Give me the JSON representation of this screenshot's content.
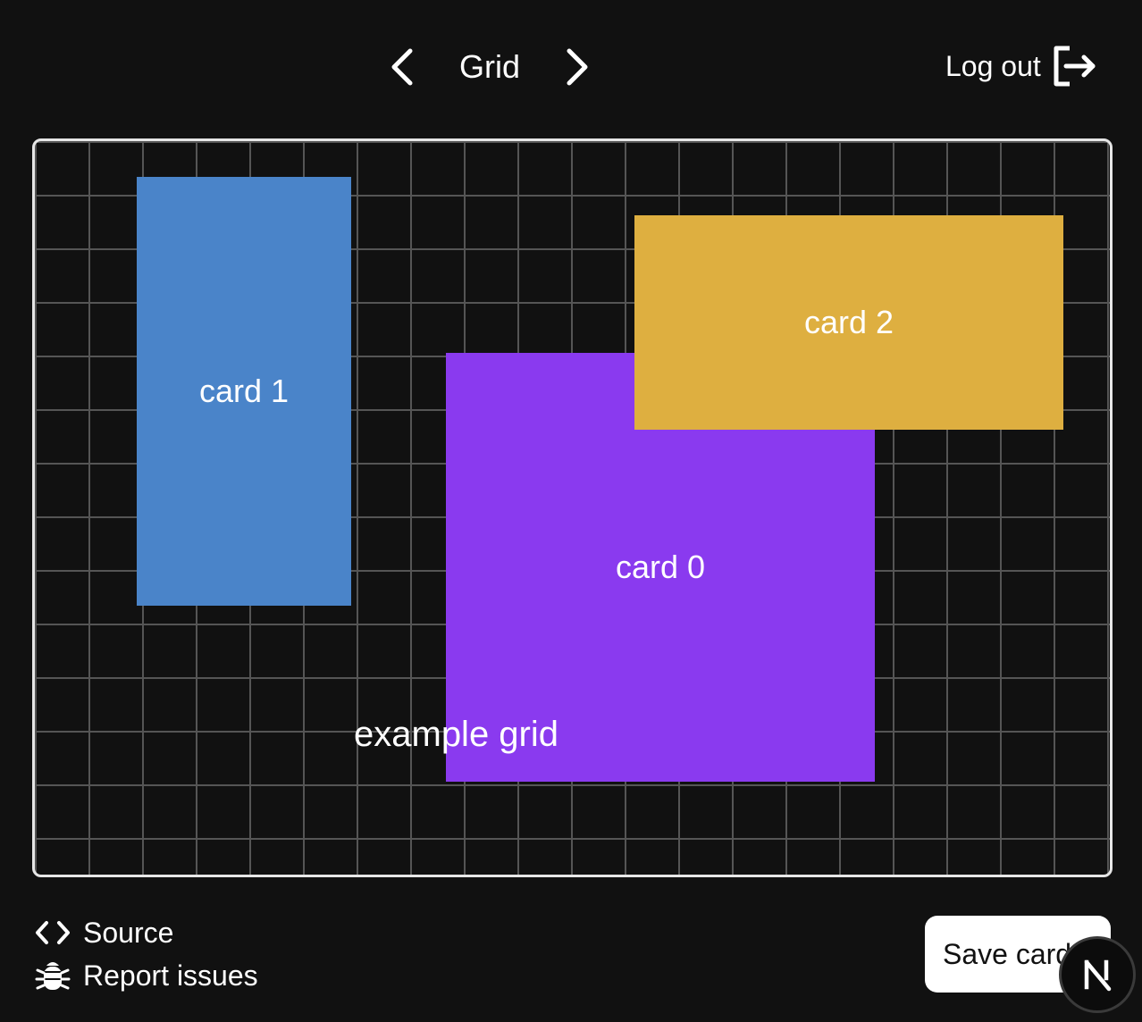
{
  "header": {
    "title": "Grid",
    "prev_icon": "chevron-left-icon",
    "next_icon": "chevron-right-icon",
    "logout_label": "Log out",
    "logout_icon": "logout-icon"
  },
  "board": {
    "label": "example grid",
    "cards": [
      {
        "label": "card 1",
        "color": "#4a84c9"
      },
      {
        "label": "card 0",
        "color": "#8a3aef"
      },
      {
        "label": "card 2",
        "color": "#deaf40"
      }
    ]
  },
  "footer": {
    "source_label": "Source",
    "source_icon": "code-icon",
    "report_label": "Report issues",
    "report_icon": "bug-icon",
    "save_label": "Save cards",
    "badge_icon": "nextjs-logo-icon"
  },
  "colors": {
    "background": "#111111",
    "grid_line": "#555555",
    "board_border": "#e6e6e6"
  }
}
